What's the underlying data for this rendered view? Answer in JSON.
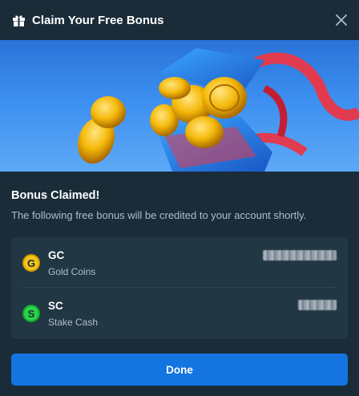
{
  "header": {
    "title": "Claim Your Free Bonus",
    "icon": "gift-icon",
    "close_icon": "close-icon"
  },
  "banner": {
    "description_icon": "treasure-box-illustration"
  },
  "bonus": {
    "title": "Bonus Claimed!",
    "description": "The following free bonus will be credited to your account shortly."
  },
  "currencies": [
    {
      "symbol": "G",
      "code": "GC",
      "name": "Gold Coins",
      "color": "#f5c518"
    },
    {
      "symbol": "S",
      "code": "SC",
      "name": "Stake Cash",
      "color": "#2bd44b"
    }
  ],
  "actions": {
    "done_label": "Done"
  },
  "colors": {
    "background": "#1a2c38",
    "card": "#213743",
    "accent": "#1475e1",
    "muted_text": "#b1bad3"
  }
}
